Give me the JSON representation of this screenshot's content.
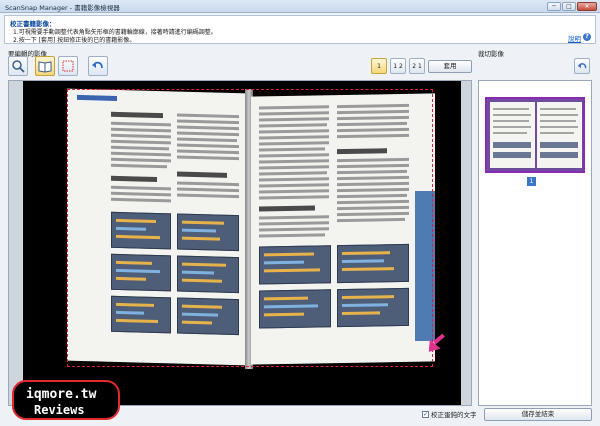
{
  "window": {
    "title": "ScanSnap Manager - 書籍影像檢視器",
    "minimize": "─",
    "maximize": "□",
    "close": "✕"
  },
  "info": {
    "heading": "校正書籍影像：",
    "line1": "1.可視需要手動調整代表角點矢形框的書籍輪廓線，接著時請進行編碼調整。",
    "line2": "2.按一下 [套用] 按鈕修正後的已的書籍影像。",
    "help": "說明",
    "help_icon": "?"
  },
  "editor": {
    "label": "要編輯的影像",
    "page_buttons": [
      "1",
      "1 2",
      "2 1"
    ],
    "apply": "套用"
  },
  "preview": {
    "label": "裁切影像",
    "page_number": "1"
  },
  "footer": {
    "checkbox_label": "校正蛋鈍的文字",
    "checkbox_checked": "✓",
    "save": "儲存並結束"
  },
  "watermark": {
    "line1": "iqmore.tw",
    "line2": "Reviews"
  },
  "colors": {
    "crop_line": "#e0203a",
    "arrow": "#e0318e",
    "thumb_frame": "#8a2bb5"
  }
}
